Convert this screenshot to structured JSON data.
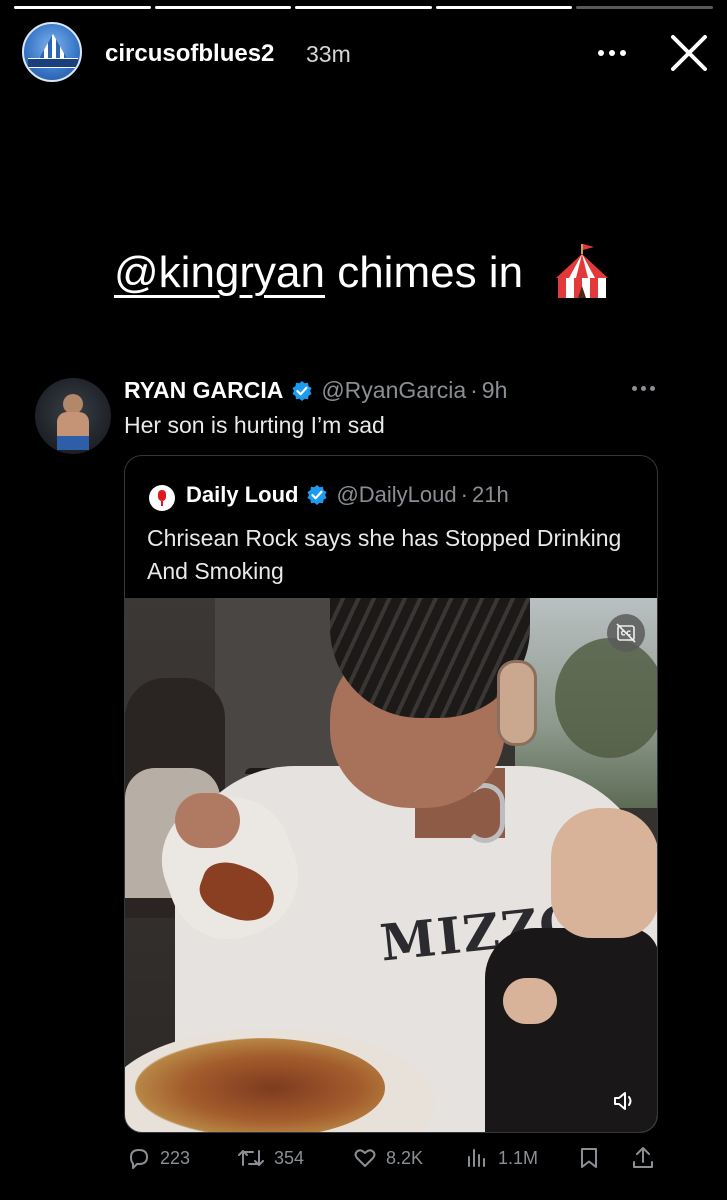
{
  "story": {
    "progress": [
      1,
      1,
      1,
      1,
      0
    ],
    "username": "circusofblues2",
    "time_ago": "33m",
    "caption_mention": "@kingryan",
    "caption_rest": " chimes in"
  },
  "tweet": {
    "name": "RYAN GARCIA",
    "handle": "@RyanGarcia",
    "separator": "·",
    "time": "9h",
    "text": "Her son is hurting I’m sad",
    "quote": {
      "name": "Daily Loud",
      "handle": "@DailyLoud",
      "separator": "·",
      "time": "21h",
      "text": "Chrisean Rock says she has Stopped Drinking And Smoking",
      "shirt_text": "MIZZO"
    },
    "stats": {
      "replies": "223",
      "retweets": "354",
      "likes": "8.2K",
      "views": "1.1M"
    }
  },
  "colors": {
    "background": "#000000",
    "verified": "#1d9bf0",
    "muted": "#8b8f94",
    "accent_red": "#e0181e"
  },
  "icons": {
    "more": "more-icon",
    "close": "close-icon",
    "verified": "verified-badge-icon",
    "reply": "reply-icon",
    "retweet": "retweet-icon",
    "like": "heart-icon",
    "views": "bar-chart-icon",
    "bookmark": "bookmark-icon",
    "share": "share-icon",
    "captions": "captions-icon",
    "volume": "volume-icon"
  }
}
